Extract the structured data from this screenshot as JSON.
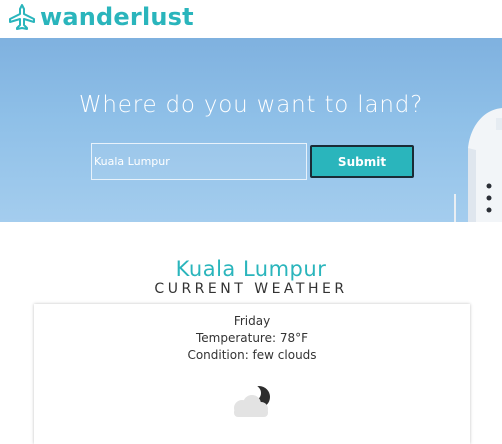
{
  "colors": {
    "brand": "#2ab5bc"
  },
  "header": {
    "logo_icon": "airplane-icon",
    "logo_text": "wanderlust"
  },
  "hero": {
    "title": "Where do you want to land?",
    "search_value": "Kuala Lumpur",
    "submit_label": "Submit"
  },
  "weather": {
    "city": "Kuala Lumpur",
    "subtitle": "CURRENT WEATHER",
    "day": "Friday",
    "temperature": "Temperature: 78°F",
    "condition": "Condition: few clouds",
    "icon": "few-clouds-night-icon"
  }
}
